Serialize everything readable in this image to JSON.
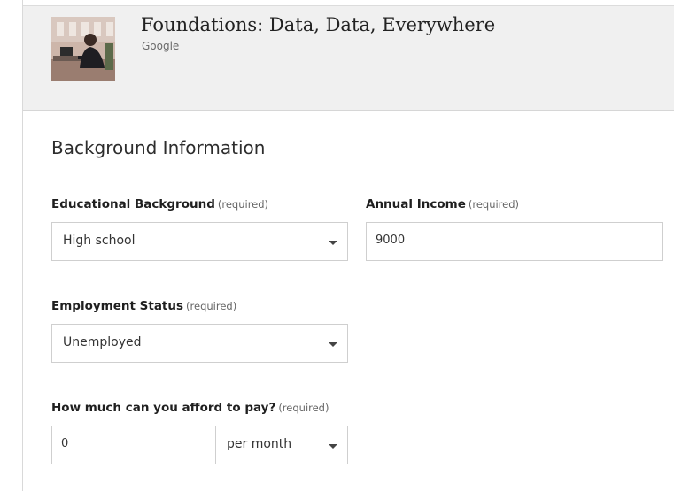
{
  "course": {
    "title": "Foundations: Data, Data, Everywhere",
    "provider": "Google"
  },
  "form": {
    "section_title": "Background Information",
    "required_tag": "(required)",
    "education": {
      "label": "Educational Background",
      "selected": "High school"
    },
    "income": {
      "label": "Annual Income",
      "value": "9000"
    },
    "employment": {
      "label": "Employment Status",
      "selected": "Unemployed"
    },
    "afford": {
      "label": "How much can you afford to pay?",
      "value": "0",
      "period_selected": "per month"
    }
  },
  "icons": {
    "dropdown": "chevron-down-icon"
  }
}
